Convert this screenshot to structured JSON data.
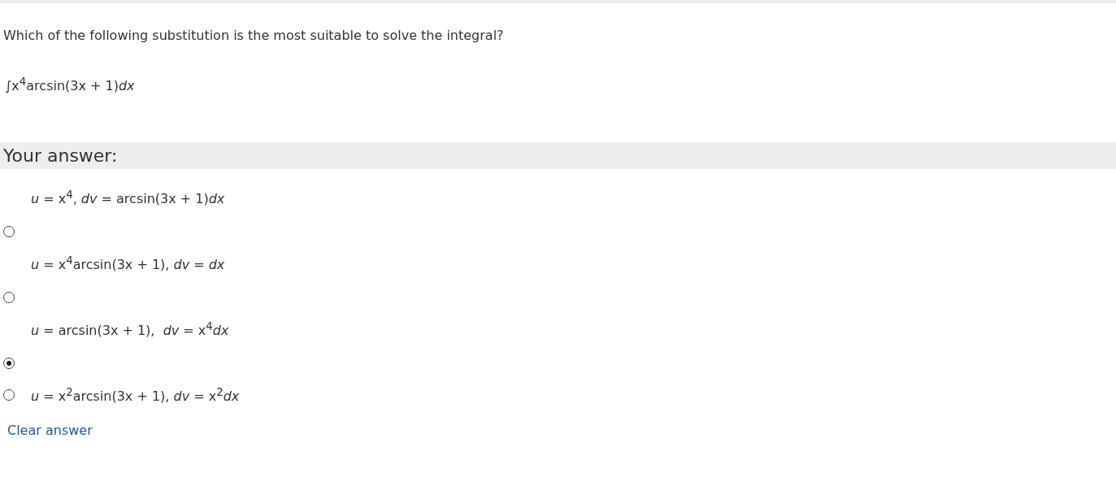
{
  "question": "Which of the following substitution is the most suitable to solve the integral?",
  "integral": "∫x$^{4}$arcsin(3x + 1)*dx*",
  "answer_heading": "Your answer:",
  "options": [
    {
      "kind": "stacked",
      "label": "*u* = x$^{4}$, *dv* = arcsin(3x + 1)*dx*",
      "selected": false
    },
    {
      "kind": "stacked",
      "label": "*u* = x$^{4}$arcsin(3x + 1), *dv* = *dx*",
      "selected": false
    },
    {
      "kind": "stacked",
      "label": "*u* = arcsin(3x + 1),  *dv* = x$^{4}$*dx*",
      "selected": true
    },
    {
      "kind": "inline",
      "label": "*u* = x$^{2}$arcsin(3x + 1), *dv* = x$^{2}$*dx*",
      "selected": false
    }
  ],
  "clear_link": "Clear answer"
}
